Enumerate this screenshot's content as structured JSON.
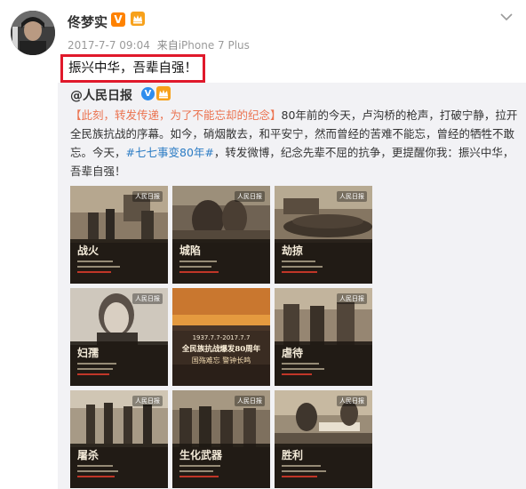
{
  "user": {
    "name": "佟梦实",
    "time": "2017-7-7 09:04",
    "source_prefix": "来自",
    "source": "iPhone 7 Plus",
    "v_badge": "V"
  },
  "post": {
    "text": "振兴中华，吾辈自强！"
  },
  "repost": {
    "author": "@人民日报",
    "highlight": "【此刻，转发传递，为了不能忘却的纪念】",
    "body1": "80年前的今天，卢沟桥的枪声，打破宁静，拉开全民族抗战的序幕。如今，硝烟散去，和平安宁，然而曾经的苦难不能忘，曾经的牺牲不敢忘。今天，",
    "hashtag": "#七七事变80年#",
    "body2": "，转发微博，纪念先辈不屈的抗争，更提醒你我：振兴中华，吾辈自强！"
  },
  "images": {
    "logo": "人民日报",
    "tiles": [
      {
        "title": "战火"
      },
      {
        "title": "城陷"
      },
      {
        "title": "劫掠"
      },
      {
        "title": "妇孺"
      },
      {
        "center_date": "1937.7.7-2017.7.7",
        "center_title": "全民族抗战爆发80周年",
        "center_sub": "国殇难忘 警钟长鸣"
      },
      {
        "title": "虐待"
      },
      {
        "title": "屠杀"
      },
      {
        "title": "生化武器"
      },
      {
        "title": "胜利"
      }
    ]
  },
  "colors": {
    "highlight_border": "#e0192b",
    "orange_v": "#ff8200",
    "blue_v": "#2e8ded",
    "link": "#2c7cc4",
    "highlight_text": "#eb7350"
  },
  "icons": {
    "more": "chevron-down-icon",
    "membership": "member-crown-icon"
  }
}
